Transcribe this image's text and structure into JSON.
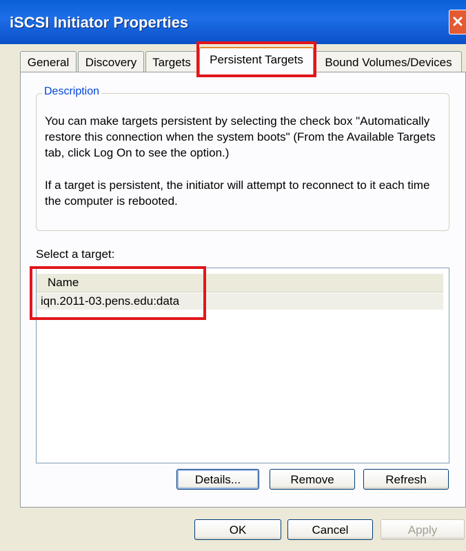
{
  "window": {
    "title": "iSCSI Initiator Properties"
  },
  "tabs": [
    {
      "label": "General"
    },
    {
      "label": "Discovery"
    },
    {
      "label": "Targets"
    },
    {
      "label": "Persistent Targets"
    },
    {
      "label": "Bound Volumes/Devices"
    }
  ],
  "active_tab": "Persistent Targets",
  "description": {
    "legend": "Description",
    "paragraph1": "You can make targets persistent by selecting the check box \"Automatically restore this connection when the system boots\" (From the Available Targets tab, click Log On to see the option.)",
    "paragraph2": "If a target is persistent, the initiator will attempt to reconnect to it each time the computer is rebooted."
  },
  "target_list": {
    "label": "Select a target:",
    "column_header": "Name",
    "rows": [
      "iqn.2011-03.pens.edu:data"
    ]
  },
  "panel_buttons": {
    "details": "Details...",
    "remove": "Remove",
    "refresh": "Refresh"
  },
  "dialog_buttons": {
    "ok": "OK",
    "cancel": "Cancel",
    "apply": "Apply"
  },
  "colors": {
    "highlight": "#e0161b",
    "titlebar": "#0a5fd6",
    "legend_text": "#0046d5"
  }
}
